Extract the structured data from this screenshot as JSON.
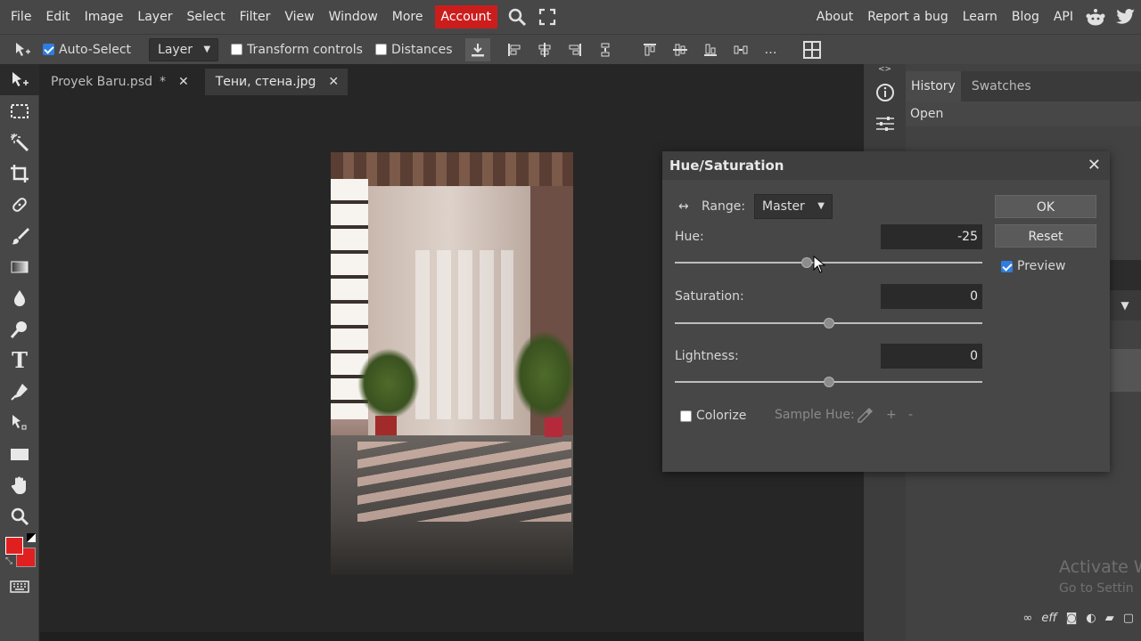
{
  "menu": {
    "items": [
      "File",
      "Edit",
      "Image",
      "Layer",
      "Select",
      "Filter",
      "View",
      "Window",
      "More"
    ],
    "account": "Account",
    "right": [
      "About",
      "Report a bug",
      "Learn",
      "Blog",
      "API"
    ]
  },
  "options": {
    "auto_select_label": "Auto-Select",
    "auto_select_checked": true,
    "layer_select": "Layer",
    "transform_label": "Transform controls",
    "distances_label": "Distances"
  },
  "tabs": [
    {
      "label": "Proyek Baru.psd",
      "modified": "*"
    },
    {
      "label": "Тени, стена.jpg"
    }
  ],
  "panel": {
    "tabs": [
      "History",
      "Swatches"
    ],
    "history_item": "Open"
  },
  "dialog": {
    "title": "Hue/Saturation",
    "range_label": "Range:",
    "range_value": "Master",
    "hue_label": "Hue:",
    "hue_value": "-25",
    "saturation_label": "Saturation:",
    "saturation_value": "0",
    "lightness_label": "Lightness:",
    "lightness_value": "0",
    "colorize_label": "Colorize",
    "sample_hue_label": "Sample Hue:",
    "plus": "+",
    "minus": "-",
    "ok_label": "OK",
    "reset_label": "Reset",
    "preview_label": "Preview",
    "preview_checked": true,
    "hue_slider_fraction": 0.43,
    "saturation_slider_fraction": 0.5,
    "lightness_slider_fraction": 0.5
  },
  "watermark": {
    "line1": "Activate W",
    "line2": "Go to Settin"
  },
  "colors": {
    "accent": "#cc1d1d",
    "foreground_color": "#e02020",
    "background_color": "#e02020",
    "check": "#2f7de1"
  }
}
